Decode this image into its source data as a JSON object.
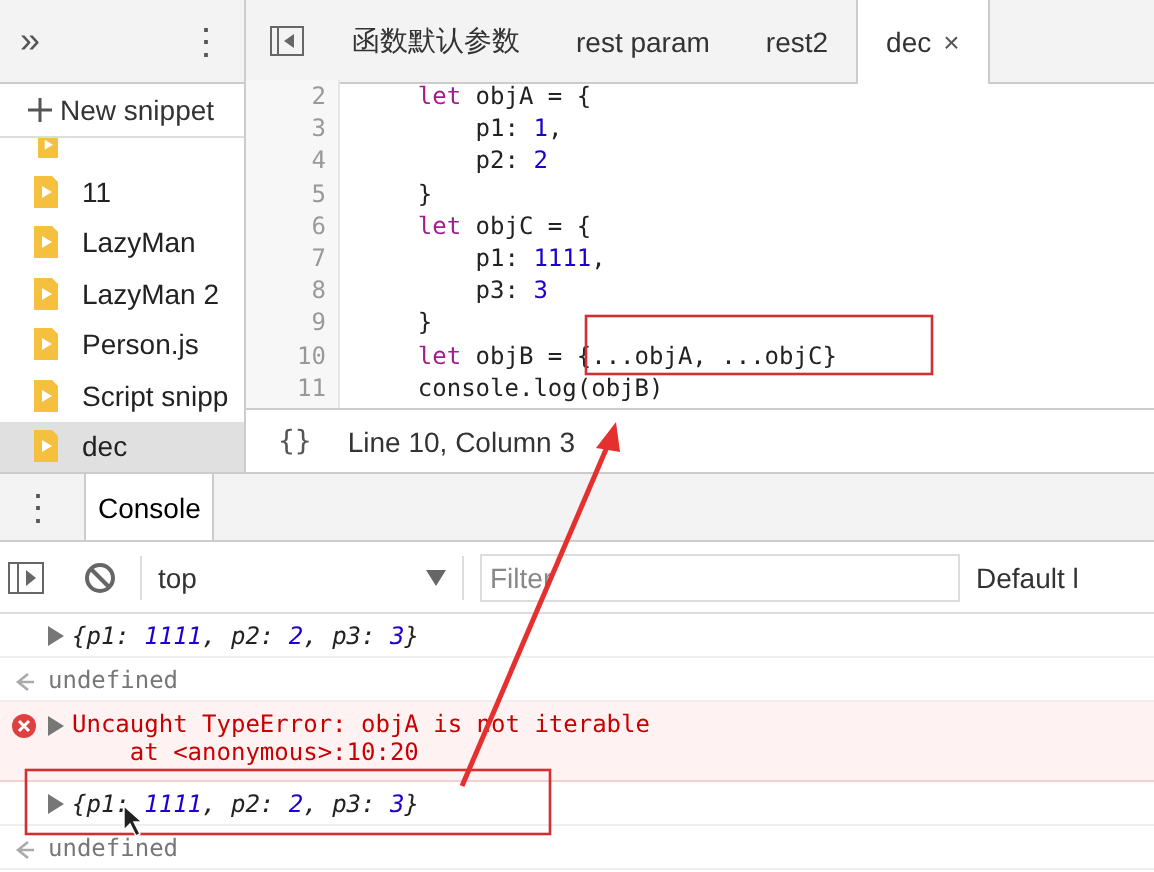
{
  "sidebar": {
    "more_tabs": "»",
    "menu": "⋮",
    "new_snippet": "New snippet",
    "items": [
      {
        "label": "11",
        "selected": false
      },
      {
        "label": "LazyMan",
        "selected": false
      },
      {
        "label": "LazyMan 2",
        "selected": false
      },
      {
        "label": "Person.js",
        "selected": false
      },
      {
        "label": "Script snipp",
        "selected": false
      },
      {
        "label": "dec",
        "selected": true
      }
    ]
  },
  "editor": {
    "tabs": [
      {
        "label": "函数默认参数",
        "selected": false,
        "closable": false
      },
      {
        "label": "rest param",
        "selected": false,
        "closable": false
      },
      {
        "label": "rest2",
        "selected": false,
        "closable": false
      },
      {
        "label": "dec",
        "selected": true,
        "closable": true
      }
    ],
    "close_glyph": "×",
    "lines": [
      {
        "number": "2",
        "tokens": [
          {
            "kind": "keyword",
            "text": "    let"
          },
          {
            "kind": "plain",
            "text": " objA = {"
          }
        ]
      },
      {
        "number": "3",
        "tokens": [
          {
            "kind": "plain",
            "text": "        p1: "
          },
          {
            "kind": "number",
            "text": "1"
          },
          {
            "kind": "plain",
            "text": ","
          }
        ]
      },
      {
        "number": "4",
        "tokens": [
          {
            "kind": "plain",
            "text": "        p2: "
          },
          {
            "kind": "number",
            "text": "2"
          }
        ]
      },
      {
        "number": "5",
        "tokens": [
          {
            "kind": "plain",
            "text": "    }"
          }
        ]
      },
      {
        "number": "6",
        "tokens": [
          {
            "kind": "keyword",
            "text": "    let"
          },
          {
            "kind": "plain",
            "text": " objC = {"
          }
        ]
      },
      {
        "number": "7",
        "tokens": [
          {
            "kind": "plain",
            "text": "        p1: "
          },
          {
            "kind": "number",
            "text": "1111"
          },
          {
            "kind": "plain",
            "text": ","
          }
        ]
      },
      {
        "number": "8",
        "tokens": [
          {
            "kind": "plain",
            "text": "        p3: "
          },
          {
            "kind": "number",
            "text": "3"
          }
        ]
      },
      {
        "number": "9",
        "tokens": [
          {
            "kind": "plain",
            "text": "    }"
          }
        ]
      },
      {
        "number": "10",
        "tokens": [
          {
            "kind": "keyword",
            "text": "    let"
          },
          {
            "kind": "plain",
            "text": " objB = {...objA, ...objC}"
          }
        ]
      },
      {
        "number": "11",
        "tokens": [
          {
            "kind": "plain",
            "text": "    console.log(objB)"
          }
        ]
      }
    ],
    "format_button": "{}",
    "status": "Line 10, Column 3"
  },
  "drawer": {
    "menu": "⋮",
    "tabs": [
      {
        "label": "Console",
        "selected": true
      }
    ],
    "context": "top",
    "filter_placeholder": "Filter",
    "levels": "Default l"
  },
  "console": [
    {
      "kind": "object",
      "tokens": [
        {
          "kind": "key",
          "text": "{p1: "
        },
        {
          "kind": "number",
          "text": "1111"
        },
        {
          "kind": "key",
          "text": ", p2: "
        },
        {
          "kind": "number",
          "text": "2"
        },
        {
          "kind": "key",
          "text": ", p3: "
        },
        {
          "kind": "number",
          "text": "3"
        },
        {
          "kind": "key",
          "text": "}"
        }
      ]
    },
    {
      "kind": "return",
      "text": "undefined"
    },
    {
      "kind": "error",
      "text": "Uncaught TypeError: objA is not iterable",
      "detail": "    at <anonymous>:10:20"
    },
    {
      "kind": "object",
      "tokens": [
        {
          "kind": "key",
          "text": "{p1: "
        },
        {
          "kind": "number",
          "text": "1111"
        },
        {
          "kind": "key",
          "text": ", p2: "
        },
        {
          "kind": "number",
          "text": "2"
        },
        {
          "kind": "key",
          "text": ", p3: "
        },
        {
          "kind": "number",
          "text": "3"
        },
        {
          "kind": "key",
          "text": "}"
        }
      ]
    },
    {
      "kind": "return",
      "text": "undefined"
    }
  ]
}
